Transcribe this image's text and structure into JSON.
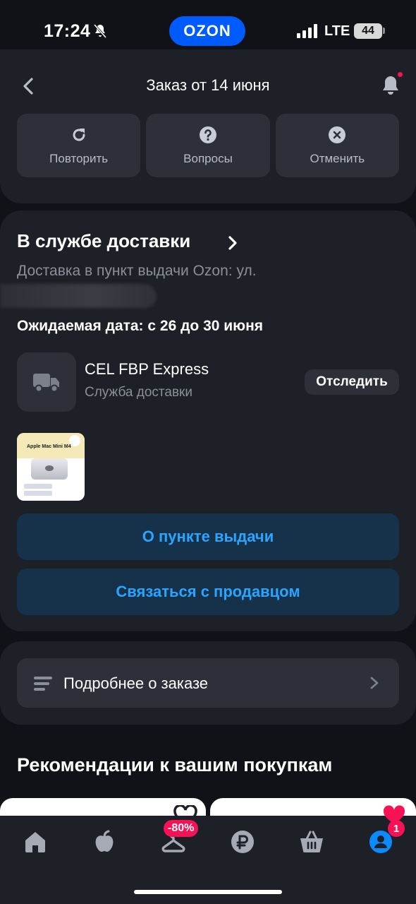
{
  "status_bar": {
    "time": "17:24",
    "network": "LTE",
    "battery": "44",
    "logo": "OZON"
  },
  "header": {
    "title": "Заказ от 14 июня",
    "actions": [
      {
        "label": "Повторить",
        "icon": "repeat-icon"
      },
      {
        "label": "Вопросы",
        "icon": "question-icon"
      },
      {
        "label": "Отменить",
        "icon": "cancel-icon"
      }
    ]
  },
  "delivery": {
    "title": "В службе доставки",
    "address": "Доставка в пункт выдачи Ozon: ул.",
    "expected_date": "Ожидаемая дата: с 26 до 30 июня",
    "carrier_name": "CEL FBP Express",
    "carrier_subtitle": "Служба доставки",
    "track_label": "Отследить",
    "product_thumb_title": "Apple Mac Mini M4",
    "pickup_button": "О пункте выдачи",
    "seller_button": "Связаться с продавцом"
  },
  "details": {
    "label": "Подробнее о заказе"
  },
  "recommendations": {
    "title": "Рекомендации к вашим покупкам"
  },
  "bottom_nav": {
    "promo_badge": "-80%",
    "profile_badge": "1",
    "accent_color": "#0a8cff"
  },
  "colors": {
    "brand": "#005bff",
    "link_blue": "#2aa5ff",
    "badge_pink": "#f91155"
  }
}
